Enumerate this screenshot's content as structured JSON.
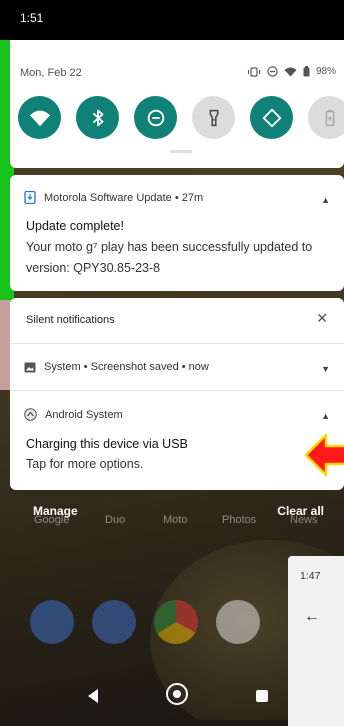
{
  "status_bar": {
    "time": "1:51"
  },
  "quick_settings": {
    "date": "Mon, Feb 22",
    "battery": "98%",
    "tiles": [
      {
        "name": "wifi",
        "state": "on"
      },
      {
        "name": "bluetooth",
        "state": "on"
      },
      {
        "name": "do-not-disturb",
        "state": "on"
      },
      {
        "name": "flashlight",
        "state": "off"
      },
      {
        "name": "auto-rotate",
        "state": "on"
      },
      {
        "name": "battery-saver",
        "state": "off"
      }
    ],
    "accent": "#0f8177"
  },
  "notifications": {
    "update": {
      "header": "Motorola Software Update • 27m",
      "title": "Update complete!",
      "body": "Your moto g⁷ play has been successfully updated to version: QPY30.85-23-8"
    },
    "silent": {
      "section_title": "Silent notifications",
      "screenshot_row": "System • Screenshot saved • now",
      "android_header": "Android System",
      "android_title": "Charging this device via USB",
      "android_body": "Tap for more options."
    }
  },
  "shade_actions": {
    "manage": "Manage",
    "clear_all": "Clear all"
  },
  "home_apps": [
    "Google",
    "Duo",
    "Moto",
    "Photos",
    "News"
  ],
  "recents_preview": {
    "time": "1:47"
  },
  "annotation": {
    "arrow_color": "#ff1a1a",
    "arrow_outline": "#ffd800"
  }
}
